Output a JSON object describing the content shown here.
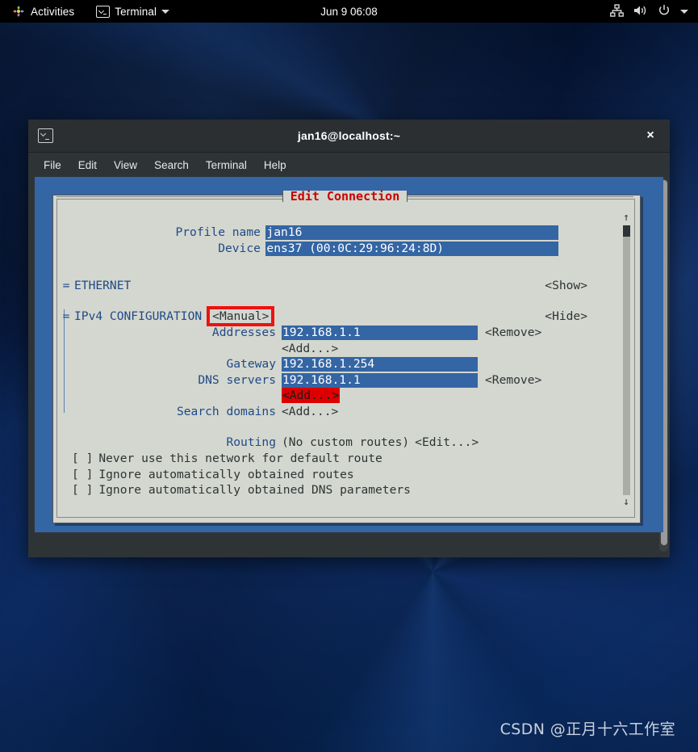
{
  "topbar": {
    "activities": "Activities",
    "app_name": "Terminal",
    "clock": "Jun 9 06:08",
    "icons": {
      "activities": "gnome-activities-icon",
      "terminal": "terminal-icon",
      "app_caret": "chevron-down-icon",
      "network": "wired-network-icon",
      "volume": "volume-icon",
      "power": "power-icon",
      "menu_caret": "chevron-down-icon"
    }
  },
  "terminal_window": {
    "title": "jan16@localhost:~",
    "close_label": "×",
    "menus": [
      "File",
      "Edit",
      "View",
      "Search",
      "Terminal",
      "Help"
    ]
  },
  "nmtui": {
    "dialog_title": "Edit Connection",
    "fields": {
      "profile_name_label": "Profile name",
      "profile_name_value": "jan16",
      "device_label": "Device",
      "device_value": "ens37 (00:0C:29:96:24:8D)"
    },
    "ethernet": {
      "marker": "=",
      "label": "ETHERNET",
      "toggle": "<Show>"
    },
    "ipv4": {
      "marker": "=",
      "label": "IPv4 CONFIGURATION",
      "method": "<Manual>",
      "toggle": "<Hide>",
      "addresses_label": "Addresses",
      "addresses_value": "192.168.1.1",
      "addresses_remove": "<Remove>",
      "addresses_add": "<Add...>",
      "gateway_label": "Gateway",
      "gateway_value": "192.168.1.254",
      "dns_label": "DNS servers",
      "dns_value": "192.168.1.1",
      "dns_remove": "<Remove>",
      "dns_add": "<Add...>",
      "search_domains_label": "Search domains",
      "search_domains_add": "<Add...>",
      "routing_label": "Routing",
      "routing_value": "(No custom routes)",
      "routing_edit": "<Edit...>",
      "checkboxes": [
        {
          "box": "[ ]",
          "label": "Never use this network for default route"
        },
        {
          "box": "[ ]",
          "label": "Ignore automatically obtained routes"
        },
        {
          "box": "[ ]",
          "label": "Ignore automatically obtained DNS parameters"
        }
      ]
    },
    "scrollbar": {
      "up": "↑",
      "down": "↓"
    },
    "highlight_color": "#dd0000",
    "accent_color": "#3465a4"
  },
  "watermark": "CSDN @正月十六工作室"
}
